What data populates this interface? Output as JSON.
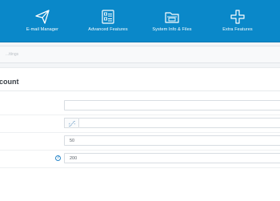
{
  "nav": {
    "items": [
      {
        "label": "E-mail Manager",
        "icon": "paper-plane-icon"
      },
      {
        "label": "Advanced Features",
        "icon": "checklist-icon"
      },
      {
        "label": "System Info & Files",
        "icon": "folder-icon"
      },
      {
        "label": "Extra Features",
        "icon": "plus-icon"
      }
    ]
  },
  "breadcrumb": {
    "text": "...ttings"
  },
  "section": {
    "title": "count"
  },
  "fields": [
    {
      "value": ""
    },
    {
      "value": "",
      "addon_icon": "link-icon"
    },
    {
      "value": "50"
    },
    {
      "value": "200",
      "help_icon": "question-icon",
      "help_text": "?"
    }
  ],
  "colors": {
    "brand": "#0a88c9",
    "accent": "#2a87c9"
  }
}
